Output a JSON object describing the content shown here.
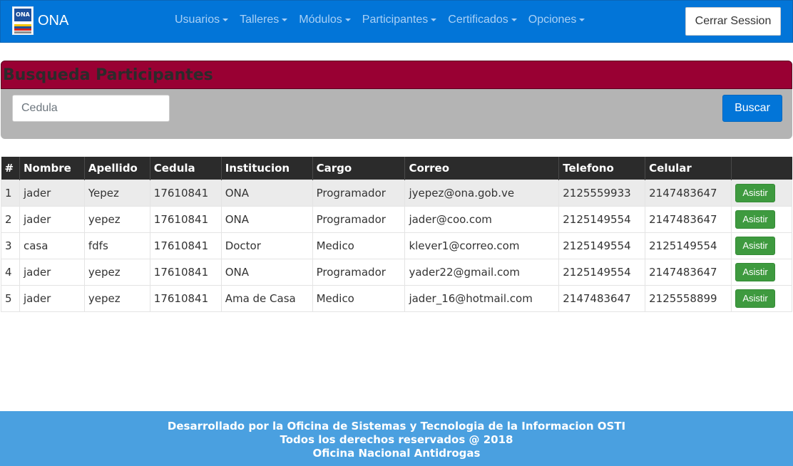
{
  "navbar": {
    "brand": "ONA",
    "logo_text": "ONA",
    "menu": [
      {
        "label": "Usuarios"
      },
      {
        "label": "Talleres"
      },
      {
        "label": "Módulos"
      },
      {
        "label": "Participantes"
      },
      {
        "label": "Certificados"
      },
      {
        "label": "Opciones"
      }
    ],
    "logout_label": "Cerrar Session"
  },
  "search": {
    "title": "Busqueda Participantes",
    "placeholder": "Cedula",
    "button_label": "Buscar"
  },
  "table": {
    "headers": [
      "#",
      "Nombre",
      "Apellido",
      "Cedula",
      "Institucion",
      "Cargo",
      "Correo",
      "Telefono",
      "Celular",
      ""
    ],
    "action_label": "Asistir",
    "rows": [
      {
        "num": "1",
        "nombre": "jader",
        "apellido": "Yepez",
        "cedula": "17610841",
        "institucion": "ONA",
        "cargo": "Programador",
        "correo": "jyepez@ona.gob.ve",
        "telefono": "2125559933",
        "celular": "2147483647"
      },
      {
        "num": "2",
        "nombre": "jader",
        "apellido": "yepez",
        "cedula": "17610841",
        "institucion": "ONA",
        "cargo": "Programador",
        "correo": "jader@coo.com",
        "telefono": "2125149554",
        "celular": "2147483647"
      },
      {
        "num": "3",
        "nombre": "casa",
        "apellido": "fdfs",
        "cedula": "17610841",
        "institucion": "Doctor",
        "cargo": "Medico",
        "correo": "klever1@correo.com",
        "telefono": "2125149554",
        "celular": "2125149554"
      },
      {
        "num": "4",
        "nombre": "jader",
        "apellido": "yepez",
        "cedula": "17610841",
        "institucion": "ONA",
        "cargo": "Programador",
        "correo": "yader22@gmail.com",
        "telefono": "2125149554",
        "celular": "2147483647"
      },
      {
        "num": "5",
        "nombre": "jader",
        "apellido": "yepez",
        "cedula": "17610841",
        "institucion": "Ama de Casa",
        "cargo": "Medico",
        "correo": "jader_16@hotmail.com",
        "telefono": "2147483647",
        "celular": "2125558899"
      }
    ]
  },
  "footer": {
    "line1": "Desarrollado por la Oficina de Sistemas y Tecnologia de la Informacion OSTI",
    "line2": "Todos los derechos reservados @ 2018",
    "line3": "Oficina Nacional Antidrogas"
  },
  "colors": {
    "navbar": "#0275d8",
    "panel_header": "#990033",
    "panel_body": "#b4b4b4",
    "action_button": "#3e9a3f",
    "footer": "#4aa0e0"
  }
}
